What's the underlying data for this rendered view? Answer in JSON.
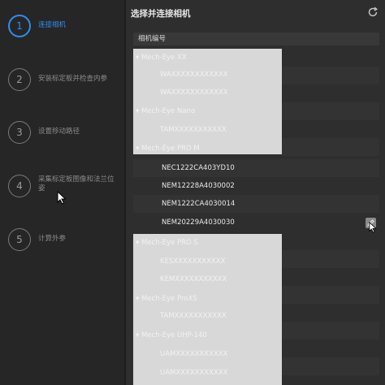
{
  "steps": [
    {
      "num": "1",
      "label": "连接相机",
      "active": true
    },
    {
      "num": "2",
      "label": "安装标定板并检查内参",
      "active": false
    },
    {
      "num": "3",
      "label": "设置移动路径",
      "active": false
    },
    {
      "num": "4",
      "label": "采集标定板图像和法兰位姿",
      "active": false
    },
    {
      "num": "5",
      "label": "计算外参",
      "active": false
    }
  ],
  "header": {
    "title": "选择并连接相机"
  },
  "list": {
    "column_header": "相机编号",
    "groups": [
      {
        "name": "Mech-Eye XX",
        "items": [
          "WAXXXXXXXXXXXX",
          "WAXXXXXXXXXXXX"
        ]
      },
      {
        "name": "Mech-Eye Nano",
        "items": [
          "TAMXXXXXXXXXXX"
        ]
      },
      {
        "name": "Mech-Eye PRO M",
        "items": [
          "NEC1222CA403YD10",
          "NEM12228A4030002",
          "NEM1222CA4030014",
          "NEM20229A4030030"
        ]
      },
      {
        "name": "Mech-Eye PRO S",
        "items": [
          "KESXXXXXXXXXXX",
          "KEMXXXXXXXXXXX"
        ]
      },
      {
        "name": "Mech-Eye ProXS",
        "items": [
          "TAMXXXXXXXXXXX"
        ]
      },
      {
        "name": "Mech-Eye UHP-140",
        "items": [
          "UAMXXXXXXXXXXX",
          "UAMXXXXXXXXXXX"
        ]
      }
    ]
  },
  "icons": {
    "refresh": "refresh-icon",
    "edit": "edit-icon"
  },
  "colors": {
    "accent": "#2f8df0",
    "redaction": "#d8d8d8"
  }
}
